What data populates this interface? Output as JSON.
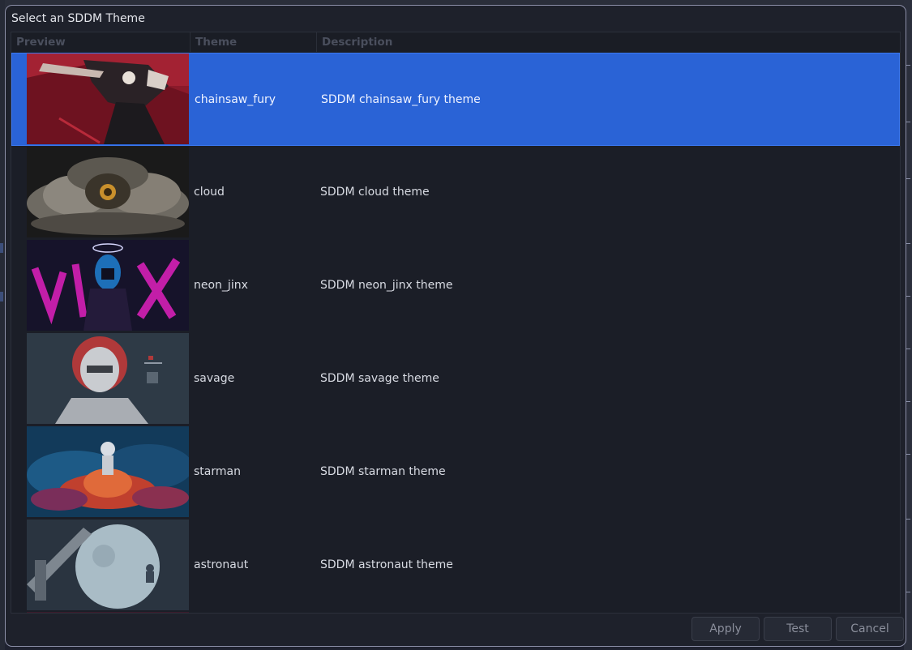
{
  "dialog": {
    "title": "Select an SDDM Theme"
  },
  "table": {
    "columns": {
      "preview": "Preview",
      "theme": "Theme",
      "description": "Description"
    },
    "rows": [
      {
        "name": "chainsaw_fury",
        "description": "SDDM chainsaw_fury theme",
        "selected": true
      },
      {
        "name": "cloud",
        "description": "SDDM cloud theme",
        "selected": false
      },
      {
        "name": "neon_jinx",
        "description": "SDDM neon_jinx theme",
        "selected": false
      },
      {
        "name": "savage",
        "description": "SDDM savage theme",
        "selected": false
      },
      {
        "name": "starman",
        "description": "SDDM starman theme",
        "selected": false
      },
      {
        "name": "astronaut",
        "description": "SDDM astronaut theme",
        "selected": false
      }
    ]
  },
  "buttons": {
    "apply": "Apply",
    "test": "Test",
    "cancel": "Cancel"
  },
  "colors": {
    "selection": "#2a63d6",
    "dialog_bg": "#1e212b"
  }
}
